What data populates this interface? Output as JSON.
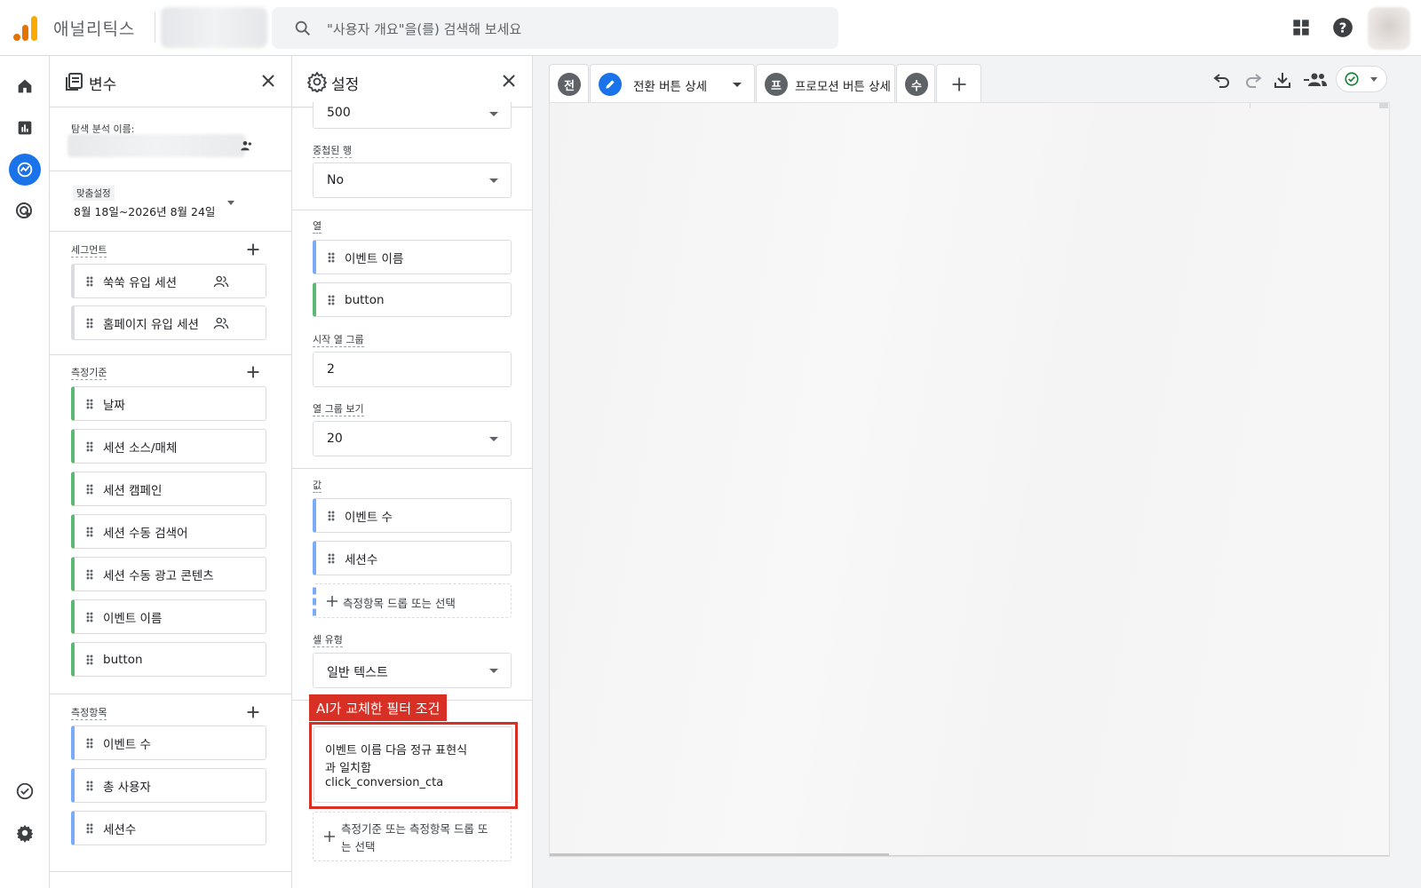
{
  "app": {
    "title": "애널리틱스"
  },
  "search": {
    "placeholder": "\"사용자 개요\"을(를) 검색해 보세요"
  },
  "colors": {
    "accent": "#1a73e8",
    "segment_border": "#5bb974",
    "metric_border": "#7baaf7",
    "annotation": "#d93025"
  },
  "rail": {
    "items": [
      "home-icon",
      "reports-icon",
      "explore-icon",
      "advertising-icon",
      "check-circle-icon",
      "gear-icon"
    ],
    "active": "explore-icon"
  },
  "variables_panel": {
    "title": "변수",
    "exploration_name_label": "탐색 분석 이름:",
    "date": {
      "tag": "맞춤설정",
      "range": "8월 18일~2026년 8월 24일"
    },
    "segments": {
      "label": "세그먼트",
      "items": [
        "쑥쑥 유입 세션",
        "홈페이지 유입 세션"
      ]
    },
    "dimensions": {
      "label": "측정기준",
      "items": [
        "날짜",
        "세션 소스/매체",
        "세션 캠페인",
        "세션 수동 검색어",
        "세션 수동 광고 콘텐츠",
        "이벤트 이름",
        "button"
      ]
    },
    "metrics": {
      "label": "측정항목",
      "items": [
        "이벤트 수",
        "총 사용자",
        "세션수"
      ]
    }
  },
  "settings_panel": {
    "title": "설정",
    "rows_value": "500",
    "nested_rows": {
      "label": "중첩된 행",
      "value": "No"
    },
    "columns": {
      "label": "열",
      "items": [
        "이벤트 이름",
        "button"
      ]
    },
    "start_column_group": {
      "label": "시작 열 그룹",
      "value": "2"
    },
    "show_column_groups": {
      "label": "열 그룹 보기",
      "value": "20"
    },
    "values": {
      "label": "값",
      "items": [
        "이벤트 수",
        "세션수"
      ],
      "drop_text": "측정항목 드롭 또는 선택"
    },
    "cell_type": {
      "label": "셀 유형",
      "value": "일반 텍스트"
    },
    "filter": {
      "annotation": "AI가 교체한 필터 조건",
      "lines": [
        "이벤트 이름 다음 정규 표현식",
        "과 일치함",
        "click_conversion_cta"
      ],
      "drop_text_1": "측정기준 또는 측정항목 드롭 또",
      "drop_text_2": "는 선택"
    }
  },
  "tabs": [
    {
      "badge": "전",
      "label": ""
    },
    {
      "badge": "",
      "label": "전환 버튼 상세",
      "active": true
    },
    {
      "badge": "프",
      "label": "프로모션 버튼 상세"
    },
    {
      "badge": "수",
      "label": ""
    }
  ],
  "toolbar": {
    "icons": [
      "undo-icon",
      "redo-icon",
      "download-icon",
      "share-icon",
      "status-check-icon"
    ]
  }
}
